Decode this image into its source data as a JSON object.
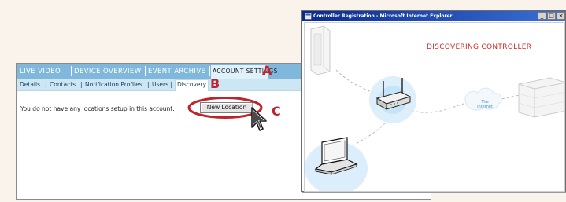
{
  "app": {
    "top_tabs": [
      {
        "label": "LIVE VIDEO"
      },
      {
        "label": "DEVICE OVERVIEW"
      },
      {
        "label": "EVENT ARCHIVE"
      },
      {
        "label": "ACCOUNT SETTINGS"
      }
    ],
    "sub_tabs": [
      {
        "label": "Details"
      },
      {
        "label": "Contacts"
      },
      {
        "label": "Notification Profiles"
      },
      {
        "label": "Users"
      },
      {
        "label": "Discovery"
      }
    ],
    "message": "You do not have any locations setup in this account.",
    "new_location_button": "New Location",
    "callouts": {
      "a": "A",
      "b": "B",
      "c": "C"
    }
  },
  "ie_window": {
    "title": "Controller Registration - Microsoft Internet Explorer",
    "heading": "DISCOVERING CONTROLLER",
    "internet_label_line1": "The",
    "internet_label_line2": "Internet"
  },
  "colors": {
    "background": "#f9f3eb",
    "nav_blue": "#7fb8dc",
    "subnav_blue": "#cde6f4",
    "callout_red": "#c0232b",
    "heading_red": "#cc2a2a"
  }
}
